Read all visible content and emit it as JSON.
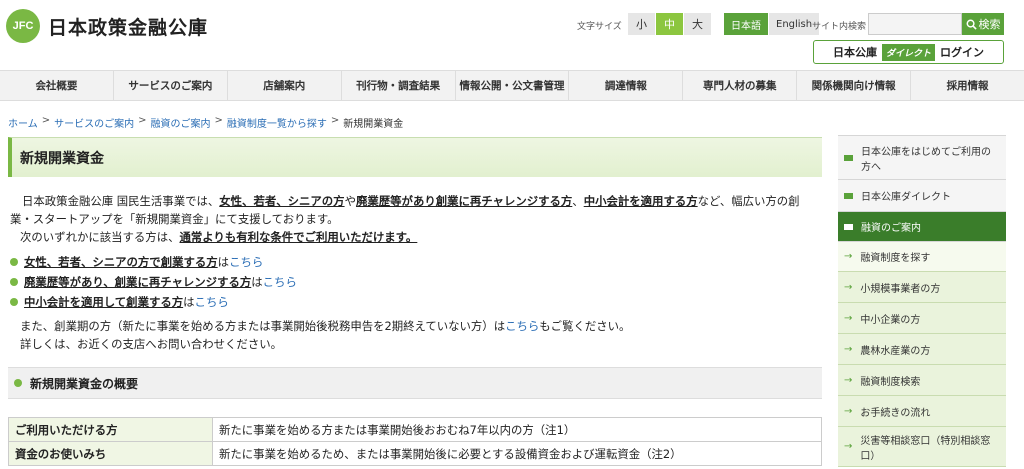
{
  "header": {
    "logo_mark": "JFC",
    "logo_text": "日本政策金融公庫",
    "font_size_label": "文字サイズ",
    "font_sizes": [
      "小",
      "中",
      "大"
    ],
    "languages": [
      "日本語",
      "English"
    ],
    "site_search_label": "サイト内検索",
    "search_placeholder": "",
    "search_button": "検索",
    "direct_prefix": "日本公庫",
    "direct_badge": "ダイレクト",
    "direct_login": "ログイン"
  },
  "nav": [
    "会社概要",
    "サービスのご案内",
    "店舗案内",
    "刊行物・調査結果",
    "情報公開・公文書管理",
    "調達情報",
    "専門人材の募集",
    "関係機関向け情報",
    "採用情報"
  ],
  "breadcrumb": [
    "ホーム",
    "サービスのご案内",
    "融資のご案内",
    "融資制度一覧から探す",
    "新規開業資金"
  ],
  "main": {
    "title": "新規開業資金",
    "intro_a": "日本政策金融公庫 国民生活事業では、",
    "intro_u1": "女性、若者、シニアの方",
    "intro_b": "や",
    "intro_u2": "廃業歴等があり創業に再チャレンジする方",
    "intro_c": "、",
    "intro_u3": "中小会計を適用する方",
    "intro_d": "など、幅広い方の創業・スタートアップを「新規開業資金」にて支援しております。",
    "intro2_a": "次のいずれかに該当する方は、",
    "intro2_u": "通常よりも有利な条件でご利用いただけます。",
    "bullets": [
      {
        "text": "女性、若者、シニアの方で創業する方",
        "suffix": "は",
        "link": "こちら"
      },
      {
        "text": "廃業歴等があり、創業に再チャレンジする方",
        "suffix": "は",
        "link": "こちら"
      },
      {
        "text": "中小会計を適用して創業する方",
        "suffix": "は",
        "link": "こちら"
      }
    ],
    "note1_a": "また、創業期の方（新たに事業を始める方または事業開始後税務申告を2期終えていない方）は",
    "note1_link": "こちら",
    "note1_b": "もご覧ください。",
    "note2": "詳しくは、お近くの支店へお問い合わせください。",
    "overview_title": "新規開業資金の概要",
    "table": [
      {
        "head": "ご利用いただける方",
        "value": "新たに事業を始める方または事業開始後おおむね7年以内の方（注1）"
      },
      {
        "head": "資金のお使いみち",
        "value": "新たに事業を始めるため、または事業開始後に必要とする設備資金および運転資金（注2）"
      }
    ]
  },
  "sidebar": {
    "items": [
      "日本公庫をはじめてご利用の方へ",
      "日本公庫ダイレクト",
      "融資のご案内"
    ],
    "subitems": [
      "融資制度を探す",
      "小規模事業者の方",
      "中小企業の方",
      "農林水産業の方",
      "融資制度検索",
      "お手続きの流れ",
      "災害等相談窓口（特別相談窓口）"
    ]
  },
  "colors": {
    "brand_green": "#7ab844",
    "dark_green": "#3a7d2a",
    "link": "#2a6db5"
  }
}
